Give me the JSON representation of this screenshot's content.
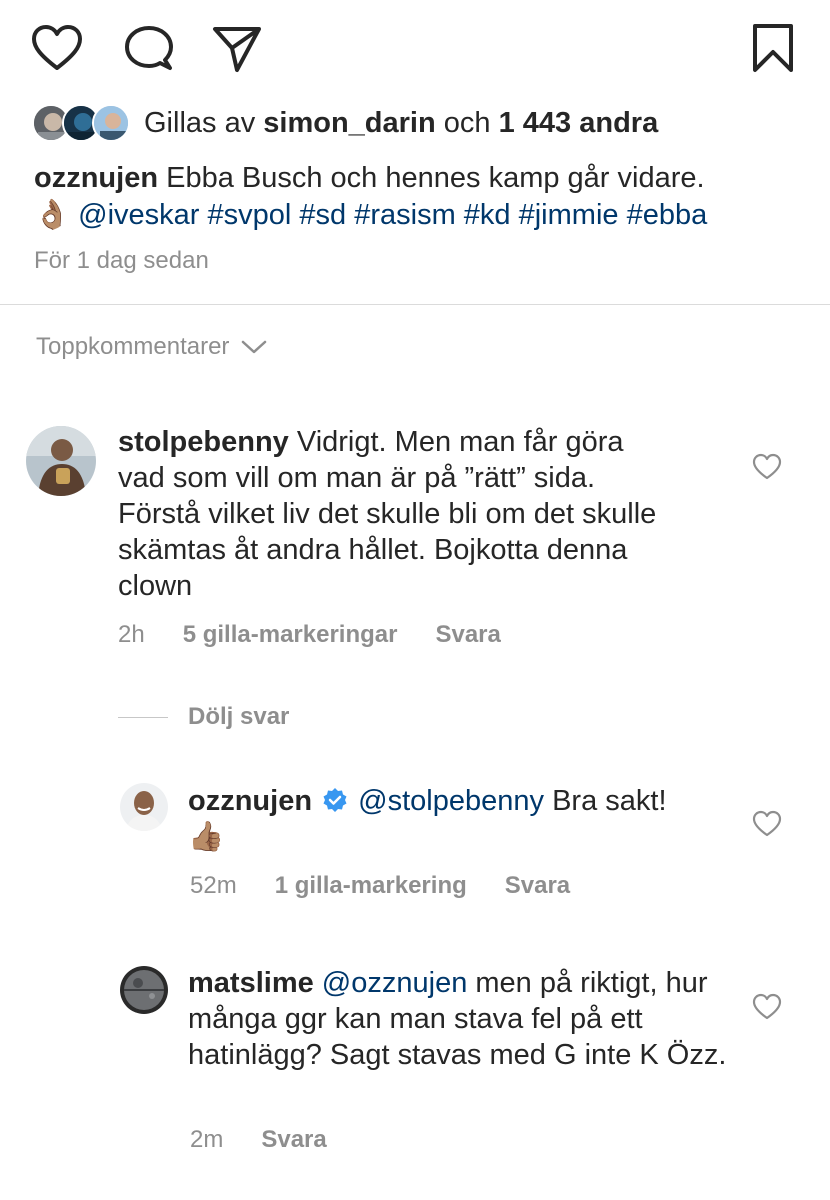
{
  "actions": {
    "like_icon": "heart-outline",
    "comment_icon": "speech-bubble",
    "share_icon": "paper-plane",
    "save_icon": "bookmark"
  },
  "likes": {
    "prefix": "Gillas av",
    "user": "simon_darin",
    "connector": "och",
    "others": "1 443 andra"
  },
  "post": {
    "author": "ozznujen",
    "caption": "Ebba Busch och hennes kamp går vidare.",
    "emoji": "👌🏽",
    "mention": "@iveskar",
    "hashtags": "#svpol #sd #rasism #kd #jimmie #ebba",
    "time": "För 1 dag sedan"
  },
  "comments_header": "Toppkommentarer",
  "comments": [
    {
      "user": "stolpebenny",
      "text": "Vidrigt. Men man får göra vad som vill om man är på ”rätt” sida. Förstå vilket liv det skulle bli om det skulle skämtas åt andra hållet. Bojkotta denna clown",
      "time": "2h",
      "likes": "5 gilla-markeringar",
      "reply": "Svara"
    }
  ],
  "hide_replies": "Dölj svar",
  "replies": [
    {
      "user": "ozznujen",
      "verified": true,
      "mention": "@stolpebenny",
      "text": "Bra sakt!",
      "emoji": "👍🏽",
      "time": "52m",
      "likes": "1 gilla-markering",
      "reply": "Svara"
    },
    {
      "user": "matslime",
      "mention": "@ozznujen",
      "text": "men på riktigt, hur många ggr kan man stava fel på ett hatinlägg? Sagt stavas med G inte K Özz.",
      "time": "2m",
      "reply": "Svara"
    }
  ],
  "colors": {
    "text": "#262626",
    "secondary": "#8e8e8e",
    "link": "#00376b",
    "verified": "#3897f0",
    "divider": "#dbdbdb"
  }
}
